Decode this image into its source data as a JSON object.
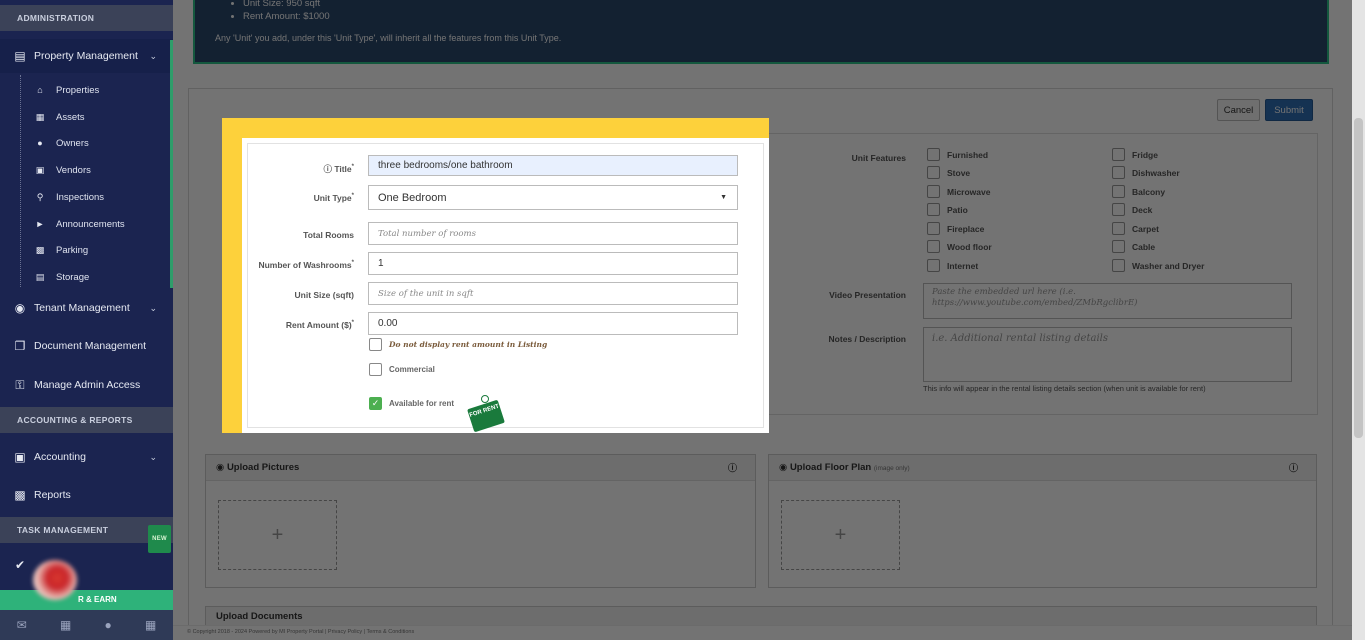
{
  "sidebar": {
    "section_admin": "ADMINISTRATION",
    "property_management": "Property Management",
    "sub_items": [
      "Properties",
      "Assets",
      "Owners",
      "Vendors",
      "Inspections",
      "Announcements",
      "Parking",
      "Storage"
    ],
    "tenant_management": "Tenant Management",
    "document_management": "Document Management",
    "manage_admin_access": "Manage Admin Access",
    "section_accounting": "ACCOUNTING & REPORTS",
    "accounting": "Accounting",
    "reports": "Reports",
    "section_task": "TASK MANAGEMENT",
    "new_badge": "NEW",
    "refer_earn": "R & EARN"
  },
  "info_box": {
    "bullets": [
      "Unit Size: 950 sqft",
      "Rent Amount: $1000"
    ],
    "note": "Any 'Unit' you add, under this 'Unit Type', will inherit all the features from this Unit Type."
  },
  "actions": {
    "cancel": "Cancel",
    "submit": "Submit"
  },
  "form": {
    "title_label": "Title",
    "title_value": "three bedrooms/one bathroom",
    "unit_type_label": "Unit Type",
    "unit_type_value": "One Bedroom",
    "total_rooms_label": "Total Rooms",
    "total_rooms_placeholder": "Total number of rooms",
    "washrooms_label": "Number of Washrooms",
    "washrooms_value": "1",
    "unit_size_label": "Unit Size (sqft)",
    "unit_size_placeholder": "Size of the unit in sqft",
    "rent_label": "Rent Amount ($)",
    "rent_value": "0.00",
    "hide_rent": "Do not display rent amount in Listing",
    "commercial": "Commercial",
    "available": "Available for rent",
    "for_rent_sign": "FOR RENT"
  },
  "features": {
    "label": "Unit Features",
    "col1": [
      "Furnished",
      "Stove",
      "Microwave",
      "Patio",
      "Fireplace",
      "Wood floor",
      "Internet"
    ],
    "col2": [
      "Fridge",
      "Dishwasher",
      "Balcony",
      "Deck",
      "Carpet",
      "Cable",
      "Washer and Dryer"
    ],
    "video_label": "Video Presentation",
    "video_placeholder_1": "Paste the embedded url here (i.e.",
    "video_placeholder_2": "https://www.youtube.com/embed/ZMbRgclibrE)",
    "notes_label": "Notes / Description",
    "notes_placeholder": "i.e. Additional rental listing details",
    "notes_help": "This info will appear in the rental listing details section (when unit is available for rent)"
  },
  "uploads": {
    "pictures": "Upload Pictures",
    "floor_plan": "Upload Floor Plan",
    "floor_plan_note": "(image only)",
    "documents": "Upload Documents",
    "plus": "+"
  },
  "footer": "© Copyright 2018 - 2024 Powered by MI Property Portal | Privacy Policy | Terms & Conditions"
}
